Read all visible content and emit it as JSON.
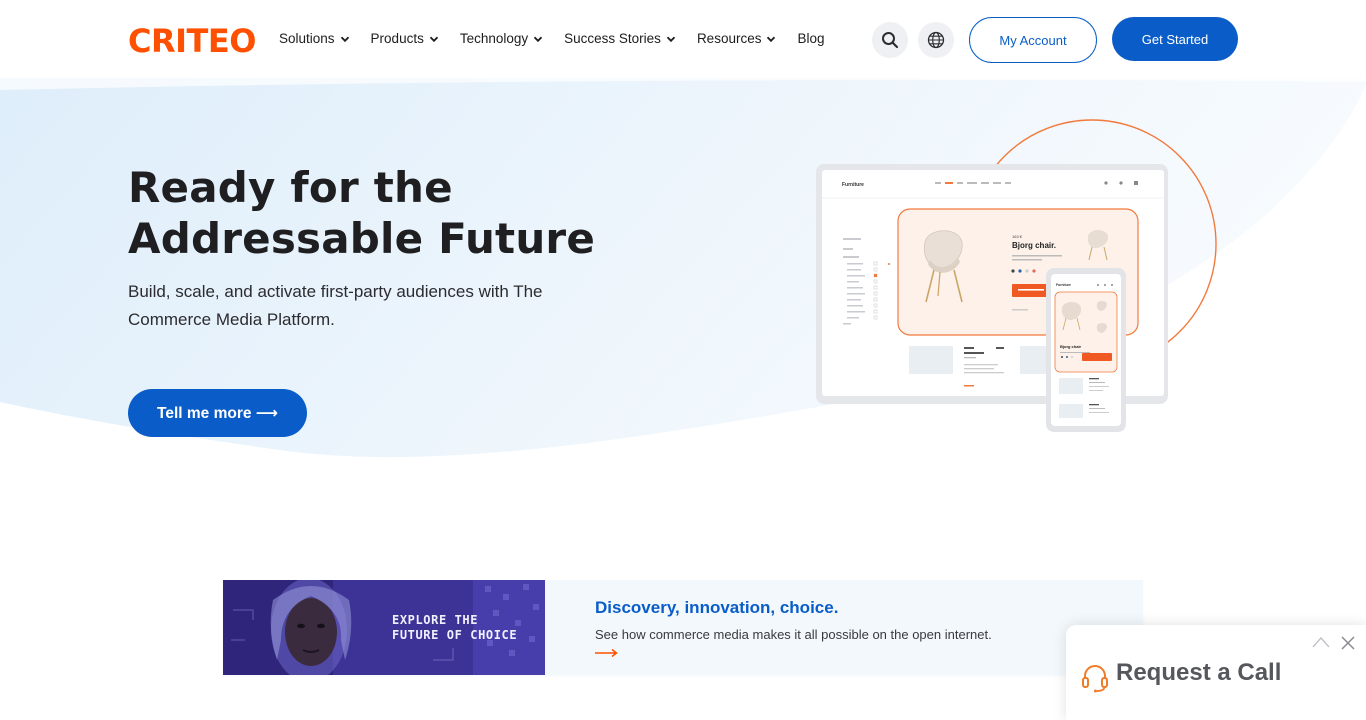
{
  "brand": {
    "logo_text": "CRITEO",
    "accent": "#fe5000",
    "primary": "#0a5dc8"
  },
  "nav": {
    "items": [
      {
        "label": "Solutions",
        "has_dropdown": true
      },
      {
        "label": "Products",
        "has_dropdown": true
      },
      {
        "label": "Technology",
        "has_dropdown": true
      },
      {
        "label": "Success Stories",
        "has_dropdown": true
      },
      {
        "label": "Resources",
        "has_dropdown": true
      },
      {
        "label": "Blog",
        "has_dropdown": false
      }
    ],
    "search_icon": "search-icon",
    "language_icon": "globe-icon",
    "account_label": "My Account",
    "get_started_label": "Get Started"
  },
  "hero": {
    "title_line1": "Ready for the",
    "title_line2": "Addressable Future",
    "subtitle": "Build, scale, and activate first-party audiences with The Commerce Media Platform.",
    "cta_label": "Tell me more ⟶"
  },
  "mockup": {
    "site_name": "Furniture",
    "product_price": "163 €",
    "product_name": "Bjorg chair.",
    "mobile_site_name": "Furniture",
    "mobile_product_name": "Bjorg chair"
  },
  "promo": {
    "image_text_line1": "EXPLORE THE",
    "image_text_line2": "FUTURE OF CHOICE",
    "title": "Discovery, innovation, choice.",
    "description": "See how commerce media makes it all possible on the open internet."
  },
  "call_widget": {
    "label": "Request a Call",
    "icon": "headset-icon"
  }
}
